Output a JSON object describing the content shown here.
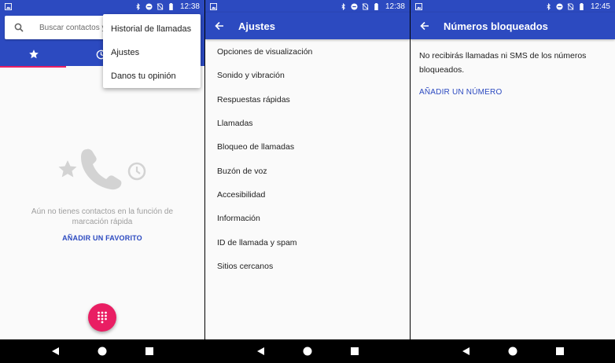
{
  "screen1": {
    "status_time": "12:38",
    "search_placeholder": "Buscar contactos y",
    "menu": [
      {
        "label": "Historial de llamadas"
      },
      {
        "label": "Ajustes"
      },
      {
        "label": "Danos tu opinión"
      }
    ],
    "empty_text": "Aún no tienes contactos en la función de marcación rápida",
    "add_favorite": "AÑADIR UN FAVORITO"
  },
  "screen2": {
    "status_time": "12:38",
    "title": "Ajustes",
    "items": [
      {
        "label": "Opciones de visualización"
      },
      {
        "label": "Sonido y vibración"
      },
      {
        "label": "Respuestas rápidas"
      },
      {
        "label": "Llamadas"
      },
      {
        "label": "Bloqueo de llamadas"
      },
      {
        "label": "Buzón de voz"
      },
      {
        "label": "Accesibilidad"
      },
      {
        "label": "Información"
      },
      {
        "label": "ID de llamada y spam"
      },
      {
        "label": "Sitios cercanos"
      }
    ]
  },
  "screen3": {
    "status_time": "12:45",
    "title": "Números bloqueados",
    "description": "No recibirás llamadas ni SMS de los números bloqueados.",
    "add_number": "AÑADIR UN NÚMERO"
  },
  "colors": {
    "primary": "#2c4ac0",
    "accent": "#e91e63",
    "background": "#fafafa"
  },
  "icons": {
    "status": [
      "image-icon",
      "bluetooth-icon",
      "do-not-disturb-icon",
      "no-sim-icon",
      "battery-icon"
    ],
    "navigation": [
      "back-icon",
      "home-icon",
      "recents-icon"
    ]
  }
}
